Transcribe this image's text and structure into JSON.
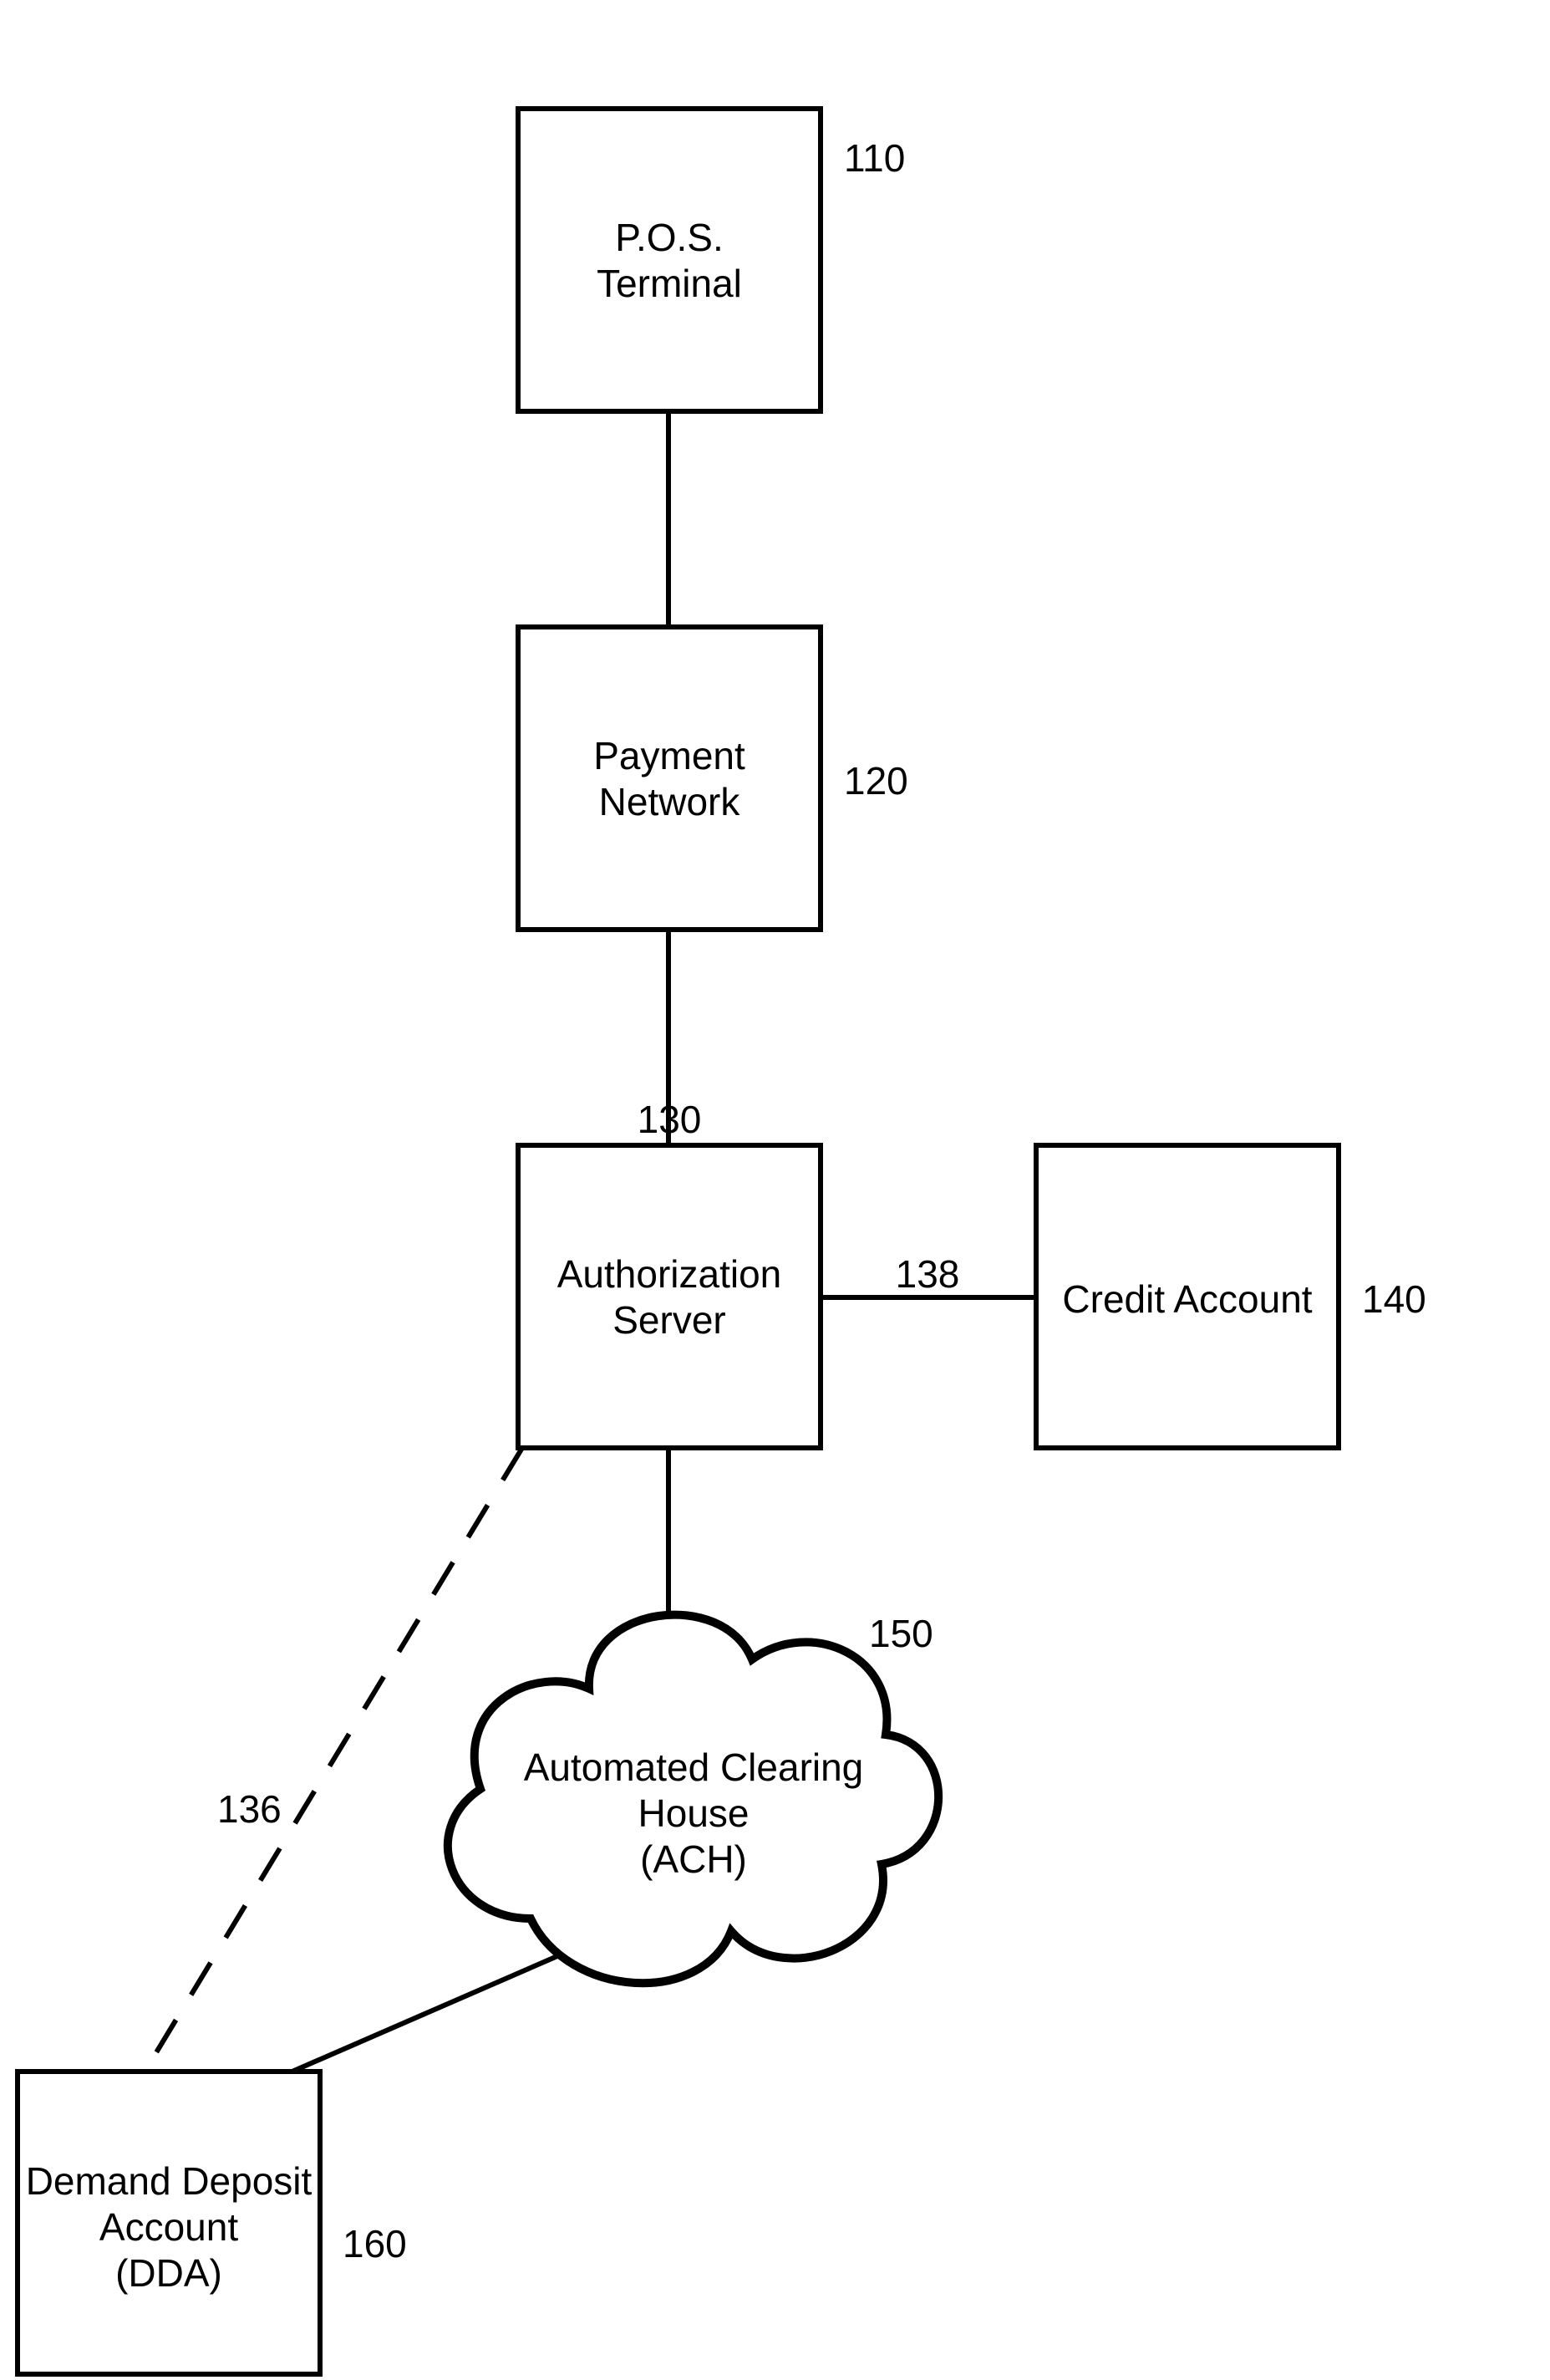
{
  "nodes": {
    "pos": {
      "lines": [
        "P.O.S.",
        "Terminal"
      ],
      "ref": "110"
    },
    "pay": {
      "lines": [
        "Payment",
        "Network"
      ],
      "ref": "120"
    },
    "auth": {
      "lines": [
        "Authorization",
        "Server"
      ],
      "ref": "130"
    },
    "credit": {
      "lines": [
        "Credit Account"
      ],
      "ref": "140"
    },
    "ach": {
      "lines": [
        "Automated Clearing",
        "House",
        "(ACH)"
      ],
      "ref": "150"
    },
    "dda": {
      "lines": [
        "Demand Deposit",
        "Account",
        "(DDA)"
      ],
      "ref": "160"
    }
  },
  "edge_labels": {
    "auth_dda": "136",
    "auth_credit": "138"
  }
}
